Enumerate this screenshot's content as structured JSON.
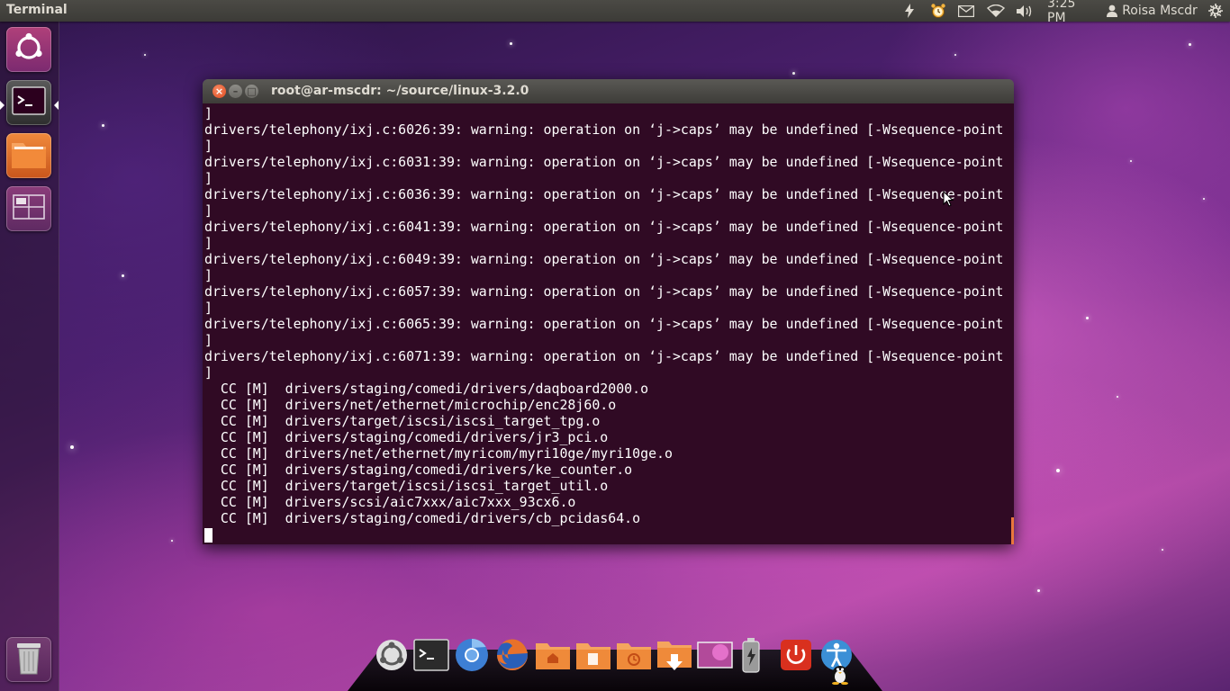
{
  "top_panel": {
    "app_title": "Terminal",
    "clock": "3:25 PM",
    "user_name": "Roisa Mscdr",
    "indicators": [
      "power-icon",
      "alarm-clock-icon",
      "mail-icon",
      "wifi-icon",
      "volume-icon",
      "user-icon",
      "gear-icon"
    ]
  },
  "launcher": {
    "items": [
      "dash-home-icon",
      "terminal-icon",
      "files-folder-icon",
      "workspace-switcher-icon"
    ],
    "bottom_item": "trash-icon"
  },
  "window": {
    "title": "root@ar-mscdr: ~/source/linux-3.2.0",
    "buttons": {
      "close": "×",
      "minimize": "–",
      "maximize": "□"
    }
  },
  "terminal": {
    "lines": [
      "]",
      "drivers/telephony/ixj.c:6026:39: warning: operation on ‘j->caps’ may be undefined [-Wsequence-point",
      "]",
      "drivers/telephony/ixj.c:6031:39: warning: operation on ‘j->caps’ may be undefined [-Wsequence-point",
      "]",
      "drivers/telephony/ixj.c:6036:39: warning: operation on ‘j->caps’ may be undefined [-Wsequence-point",
      "]",
      "drivers/telephony/ixj.c:6041:39: warning: operation on ‘j->caps’ may be undefined [-Wsequence-point",
      "]",
      "drivers/telephony/ixj.c:6049:39: warning: operation on ‘j->caps’ may be undefined [-Wsequence-point",
      "]",
      "drivers/telephony/ixj.c:6057:39: warning: operation on ‘j->caps’ may be undefined [-Wsequence-point",
      "]",
      "drivers/telephony/ixj.c:6065:39: warning: operation on ‘j->caps’ may be undefined [-Wsequence-point",
      "]",
      "drivers/telephony/ixj.c:6071:39: warning: operation on ‘j->caps’ may be undefined [-Wsequence-point",
      "]",
      "  CC [M]  drivers/staging/comedi/drivers/daqboard2000.o",
      "  CC [M]  drivers/net/ethernet/microchip/enc28j60.o",
      "  CC [M]  drivers/target/iscsi/iscsi_target_tpg.o",
      "  CC [M]  drivers/staging/comedi/drivers/jr3_pci.o",
      "  CC [M]  drivers/net/ethernet/myricom/myri10ge/myri10ge.o",
      "  CC [M]  drivers/staging/comedi/drivers/ke_counter.o",
      "  CC [M]  drivers/target/iscsi/iscsi_target_util.o",
      "  CC [M]  drivers/scsi/aic7xxx/aic7xxx_93cx6.o",
      "  CC [M]  drivers/staging/comedi/drivers/cb_pcidas64.o"
    ]
  },
  "dock": {
    "items": [
      "ubuntu-dash-icon",
      "terminal-icon",
      "chromium-icon",
      "firefox-icon",
      "home-folder-icon",
      "documents-folder-icon",
      "history-folder-icon",
      "downloads-folder-icon",
      "desktop-wallpaper-icon",
      "battery-icon",
      "shutdown-icon",
      "accessibility-icon"
    ],
    "trailing_icon": "tux-penguin-icon"
  },
  "colors": {
    "terminal_background": "#300a24",
    "terminal_text": "#ffffff",
    "close_button": "#df4a1f",
    "panel": "#3c3b37",
    "scrollbar_accent": "#e9773c"
  }
}
